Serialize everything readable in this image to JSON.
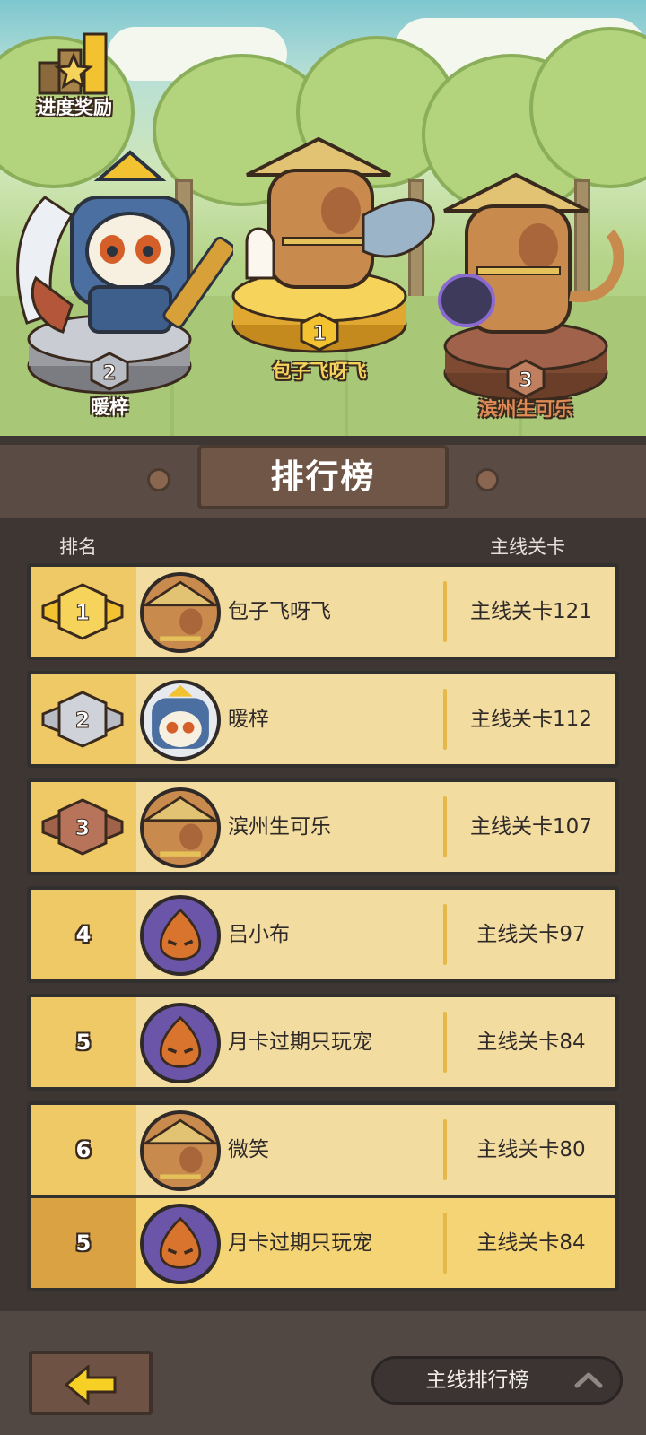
{
  "progress_reward": {
    "label": "进度奖励",
    "icon": "trophy-star-icon"
  },
  "podium": [
    {
      "rank": "1",
      "name": "包子飞呀飞",
      "name_color": "#f6d35a"
    },
    {
      "rank": "2",
      "name": "暖梓",
      "name_color": "#ffffff"
    },
    {
      "rank": "3",
      "name": "滨州生可乐",
      "name_color": "#e08a55"
    }
  ],
  "board": {
    "title": "排行榜",
    "col_rank": "排名",
    "col_stage": "主线关卡"
  },
  "rows": [
    {
      "rank": "1",
      "name": "包子飞呀飞",
      "stage": "主线关卡121",
      "avatar": "capybara-straw-hat"
    },
    {
      "rank": "2",
      "name": "暖梓",
      "stage": "主线关卡112",
      "avatar": "samurai-panda"
    },
    {
      "rank": "3",
      "name": "滨州生可乐",
      "stage": "主线关卡107",
      "avatar": "capybara-straw-hat"
    },
    {
      "rank": "4",
      "name": "吕小布",
      "stage": "主线关卡97",
      "avatar": "chestnut"
    },
    {
      "rank": "5",
      "name": "月卡过期只玩宠",
      "stage": "主线关卡84",
      "avatar": "chestnut"
    },
    {
      "rank": "6",
      "name": "微笑",
      "stage": "主线关卡80",
      "avatar": "capybara-straw-hat"
    }
  ],
  "my_row": {
    "rank": "5",
    "name": "月卡过期只玩宠",
    "stage": "主线关卡84",
    "avatar": "chestnut"
  },
  "footer": {
    "back_icon": "back-arrow-icon",
    "switch_label": "主线排行榜",
    "switch_icon": "chevron-up-icon"
  },
  "colors": {
    "gold": "#f2c230",
    "silver": "#b8bcc4",
    "bronze": "#a0624a",
    "row_bg": "#f3dca0",
    "rank_bg": "#efc965"
  }
}
